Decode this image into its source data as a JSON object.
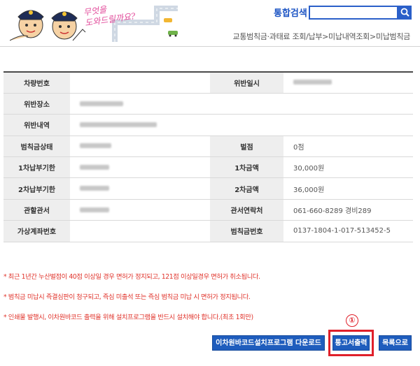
{
  "header": {
    "slogan_line1": "무엇을",
    "slogan_line2": "도와드릴까요?",
    "search_label": "통합검색",
    "search_value": "",
    "breadcrumb": "교통범칙금·과태료 조회/납부>미납내역조회>미납범칙금"
  },
  "table": {
    "rows": [
      {
        "label": "차량번호",
        "value": "",
        "label2": "위반일시",
        "value2": ""
      },
      {
        "label": "위반장소",
        "value": ""
      },
      {
        "label": "위반내역",
        "value": ""
      },
      {
        "label": "범칙금상태",
        "value": "",
        "label2": "벌점",
        "value2": "0점"
      },
      {
        "label": "1차납부기한",
        "value": "",
        "label2": "1차금액",
        "value2": "30,000원"
      },
      {
        "label": "2차납부기한",
        "value": "",
        "label2": "2차금액",
        "value2": "36,000원"
      },
      {
        "label": "관할관서",
        "value": "",
        "label2": "관서연락처",
        "value2": "061-660-8289 경비289"
      },
      {
        "label": "가상계좌번호",
        "value": "",
        "label2": "범칙금번호",
        "value2": "0137-1804-1-017-513452-5"
      }
    ]
  },
  "notices": [
    "* 최근 1년간 누산벌점이 40점 이상일 경우 면허가 정지되고, 121점 이상일경우 면허가 취소됩니다.",
    "* 범칙금 미납시 즉결심판이 청구되고, 즉심 미출석 또는 즉심 범칙금 미납 시 면허가 정지됩니다.",
    "* 인쇄물 발행시, 이차원바코드 출력을 위해 설치프로그램을 반드시 설치해야 합니다.(최초 1회만)"
  ],
  "buttons": {
    "barcode_download": "이차원바코드설치프로그램 다운로드",
    "print_notice": "통고서출력",
    "list": "목록으로"
  },
  "annotation": {
    "marker": "①",
    "color": "#e0202a"
  },
  "colors": {
    "accent": "#1f5dbd",
    "notice": "#e0322a"
  }
}
